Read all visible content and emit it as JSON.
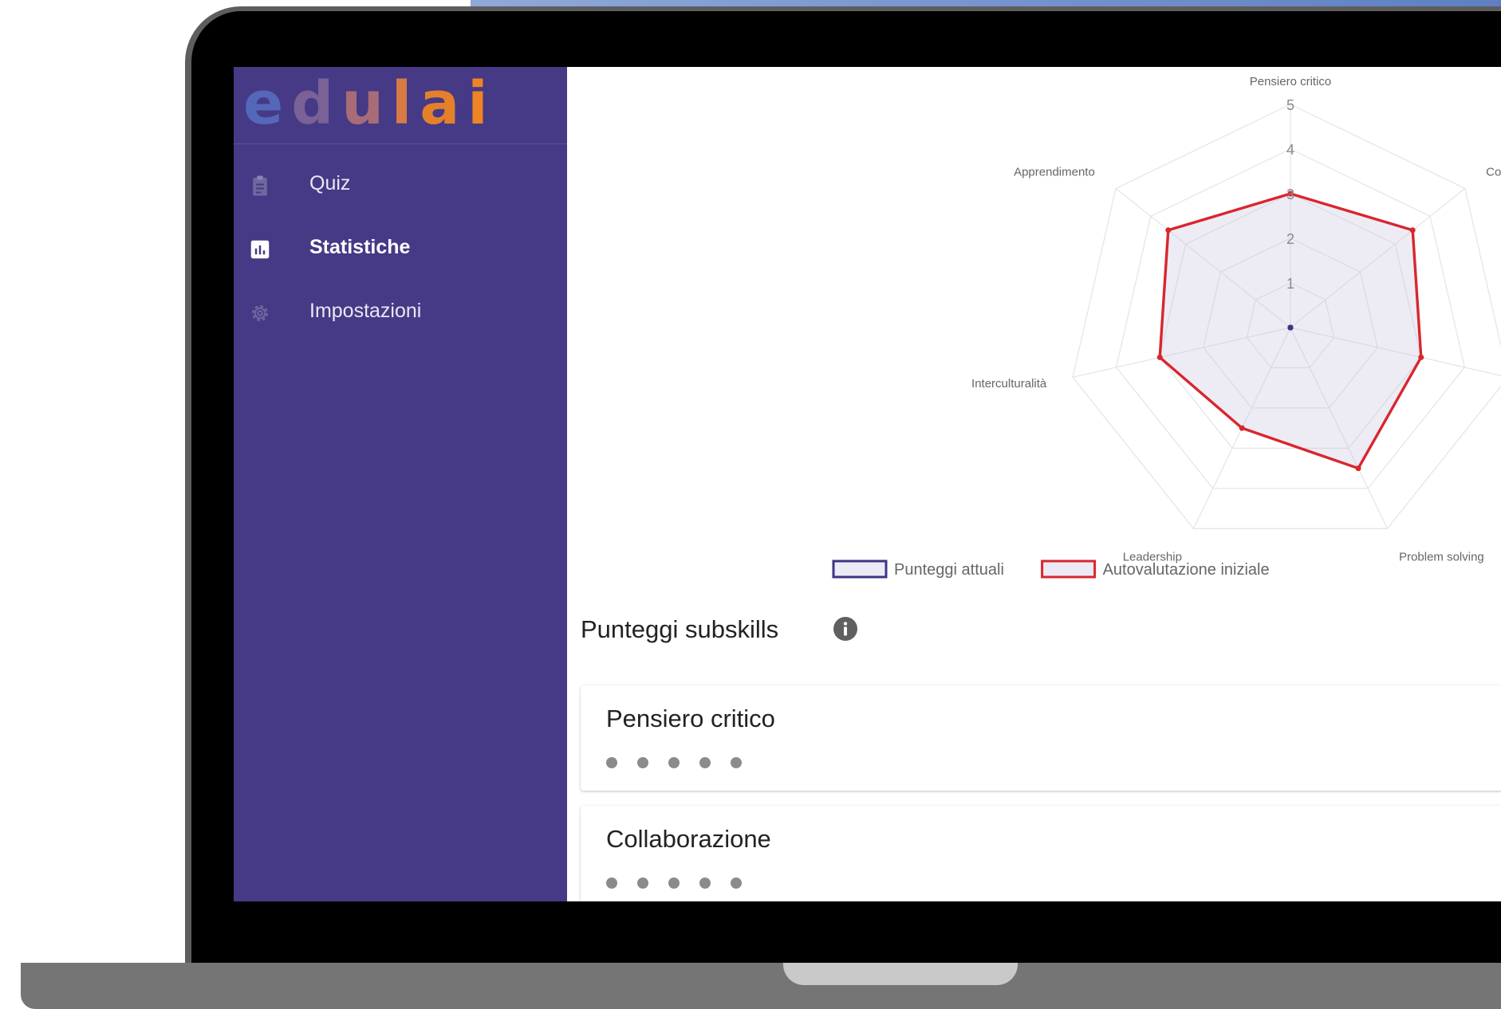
{
  "app": {
    "logo_letters": [
      "e",
      "d",
      "u",
      "l",
      "a",
      "i"
    ]
  },
  "sidebar": {
    "items": [
      {
        "label": "Quiz",
        "icon": "clipboard-icon",
        "active": false
      },
      {
        "label": "Statistiche",
        "icon": "bar-chart-icon",
        "active": true
      },
      {
        "label": "Impostazioni",
        "icon": "gear-icon",
        "active": false
      }
    ]
  },
  "chart_data": {
    "type": "radar",
    "axes": [
      "Pensiero critico",
      "Collabora",
      "Co",
      "Problem solving",
      "Leadership",
      "Interculturalità",
      "Apprendimento"
    ],
    "rlim": [
      0,
      5
    ],
    "ticks": [
      "1",
      "2",
      "3",
      "4",
      "5"
    ],
    "series": [
      {
        "name": "Punteggi attuali",
        "values": [
          0,
          0,
          0,
          0,
          0,
          0,
          0
        ],
        "color": "#3b3584"
      },
      {
        "name": "Autovalutazione iniziale",
        "values": [
          3,
          3.5,
          3,
          3.5,
          2.5,
          3,
          3.5
        ],
        "color": "#d9262e"
      }
    ],
    "legend_position": "bottom"
  },
  "subskills": {
    "title": "Punteggi subskills",
    "cards": [
      {
        "title": "Pensiero critico",
        "dots": 5
      },
      {
        "title": "Collaborazione",
        "dots": 5
      }
    ]
  }
}
